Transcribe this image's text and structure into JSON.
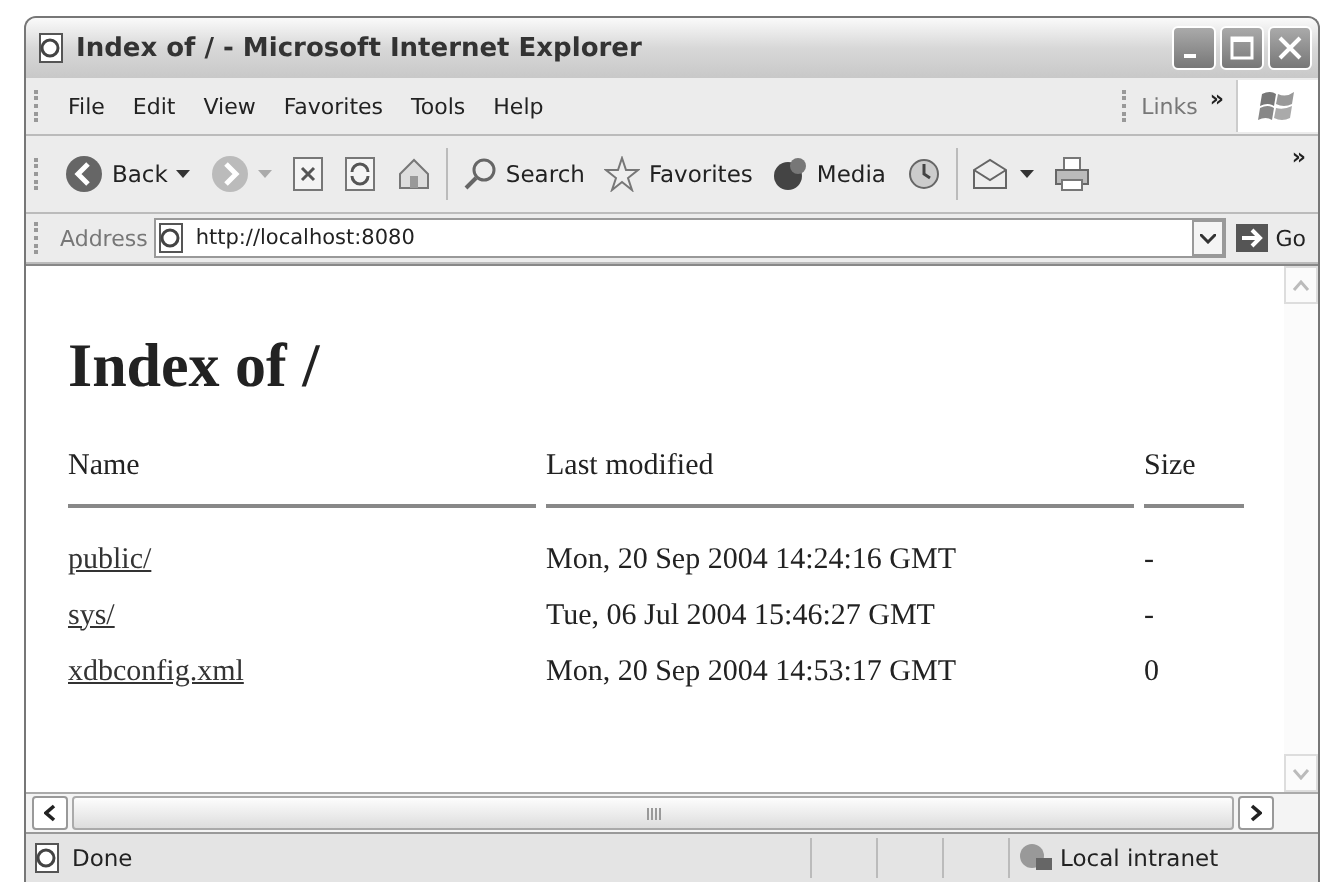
{
  "window": {
    "title": "Index of / - Microsoft Internet Explorer"
  },
  "menu": [
    "File",
    "Edit",
    "View",
    "Favorites",
    "Tools",
    "Help"
  ],
  "links": {
    "label": "Links",
    "more": "»"
  },
  "toolbar": [
    {
      "kind": "back",
      "label": "Back",
      "dropdown": true
    },
    {
      "kind": "forward",
      "dropdown": true
    },
    {
      "kind": "stop"
    },
    {
      "kind": "refresh"
    },
    {
      "kind": "home"
    },
    {
      "kind": "sep"
    },
    {
      "kind": "search",
      "label": "Search"
    },
    {
      "kind": "favorites",
      "label": "Favorites"
    },
    {
      "kind": "media",
      "label": "Media"
    },
    {
      "kind": "history"
    },
    {
      "kind": "sep"
    },
    {
      "kind": "mail",
      "dropdown": true
    },
    {
      "kind": "print"
    }
  ],
  "toolbar_more": "»",
  "address": {
    "label": "Address",
    "value": "http://localhost:8080",
    "go": "Go"
  },
  "page": {
    "heading": "Index of /",
    "columns": [
      "Name",
      "Last modified",
      "Size"
    ],
    "rows": [
      {
        "name": "public/",
        "modified": "Mon, 20 Sep 2004 14:24:16 GMT",
        "size": "-"
      },
      {
        "name": "sys/",
        "modified": "Tue, 06 Jul 2004 15:46:27 GMT",
        "size": "-"
      },
      {
        "name": "xdbconfig.xml",
        "modified": "Mon, 20 Sep 2004 14:53:17 GMT",
        "size": "0"
      }
    ]
  },
  "status_bar": {
    "text": "Done",
    "zone": "Local intranet"
  }
}
